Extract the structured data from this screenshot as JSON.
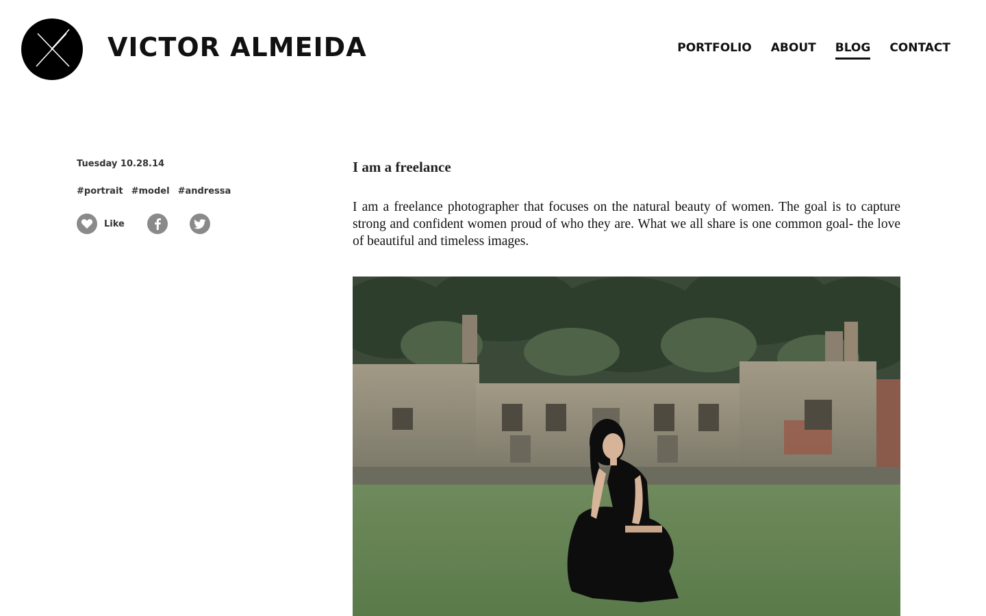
{
  "header": {
    "site_title": "VICTOR ALMEIDA",
    "logo_icon": "x-monogram-icon"
  },
  "nav": {
    "items": [
      {
        "label": "PORTFOLIO",
        "active": false
      },
      {
        "label": "ABOUT",
        "active": false
      },
      {
        "label": "BLOG",
        "active": true
      },
      {
        "label": "CONTACT",
        "active": false
      }
    ]
  },
  "post": {
    "date": "Tuesday 10.28.14",
    "tags": [
      "#portrait",
      "#model",
      "#andressa"
    ],
    "like_label": "Like",
    "title": "I am a freelance",
    "body": "I am a freelance photographer that focuses on the natural beauty of women. The goal is to capture strong and confident women proud of who they are. What we all share is one common goal- the love of beautiful and timeless images.",
    "image_icon": "photo-woman-kneeling-on-grass-before-ruins"
  },
  "social": {
    "like_icon": "heart-icon",
    "facebook_icon": "facebook-icon",
    "twitter_icon": "twitter-icon"
  },
  "colors": {
    "text": "#111111",
    "icon_grey": "#8a8a8a",
    "background": "#ffffff"
  }
}
